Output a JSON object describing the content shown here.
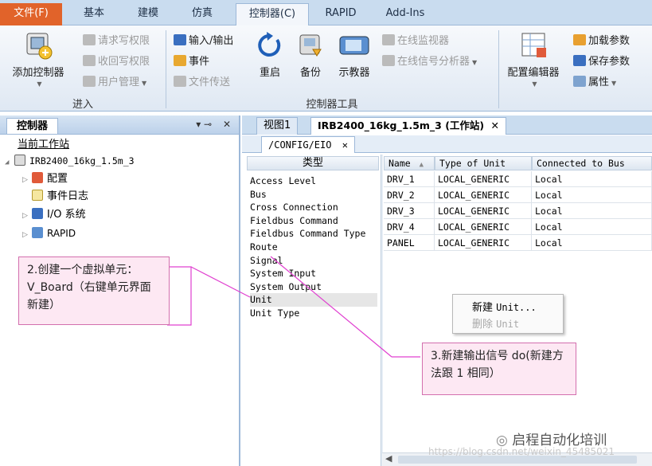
{
  "ribbon": {
    "tabs": [
      {
        "label": "文件(F)"
      },
      {
        "label": "基本"
      },
      {
        "label": "建模"
      },
      {
        "label": "仿真"
      },
      {
        "label": "控制器(C)"
      },
      {
        "label": "RAPID"
      },
      {
        "label": "Add-Ins"
      }
    ],
    "groups": {
      "input": {
        "label": "进入",
        "add_controller": "添加控制器",
        "request_write": "请求写权限",
        "recall_write": "收回写权限",
        "user_mgmt": "用户管理"
      },
      "tools": {
        "label": "控制器工具",
        "io": "输入/输出",
        "events": "事件",
        "file_transfer": "文件传送",
        "restart": "重启",
        "backup": "备份",
        "teach_pendant": "示教器",
        "online_monitor": "在线监视器",
        "online_signal": "在线信号分析器"
      },
      "config": {
        "config_editor": "配置编辑器",
        "load_params": "加载参数",
        "save_params": "保存参数",
        "properties": "属性"
      }
    }
  },
  "left_panel": {
    "title": "控制器",
    "current_station": "当前工作站",
    "station": "IRB2400_16kg_1.5m_3",
    "items": [
      {
        "label": "配置"
      },
      {
        "label": "事件日志"
      },
      {
        "label": "I/O 系统"
      },
      {
        "label": "RAPID"
      }
    ]
  },
  "doc_tabs": {
    "view1": "视图1",
    "station_tab": "IRB2400_16kg_1.5m_3 (工作站)",
    "config_tab": "/CONFIG/EIO"
  },
  "type_list": {
    "header": "类型",
    "items": [
      "Access Level",
      "Bus",
      "Cross Connection",
      "Fieldbus Command",
      "Fieldbus Command Type",
      "Route",
      "Signal",
      "System Input",
      "System Output",
      "Unit",
      "Unit Type"
    ],
    "selected": "Unit"
  },
  "grid": {
    "columns": [
      "Name",
      "Type of Unit",
      "Connected to Bus"
    ],
    "rows": [
      [
        "DRV_1",
        "LOCAL_GENERIC",
        "Local"
      ],
      [
        "DRV_2",
        "LOCAL_GENERIC",
        "Local"
      ],
      [
        "DRV_3",
        "LOCAL_GENERIC",
        "Local"
      ],
      [
        "DRV_4",
        "LOCAL_GENERIC",
        "Local"
      ],
      [
        "PANEL",
        "LOCAL_GENERIC",
        "Local"
      ]
    ]
  },
  "context_menu": {
    "new_cn": "新建",
    "new_en": "Unit...",
    "delete_cn": "删除",
    "delete_en": "Unit"
  },
  "annotations": {
    "note1": "2.创建一个虚拟单元：V_Board（右键单元界面新建）",
    "note2": "3.新建输出信号 do(新建方法跟 1 相同）"
  },
  "watermark": {
    "brand": "启程自动化培训",
    "url": "https://blog.csdn.net/weixin_45485021"
  },
  "colors": {
    "file_tab": "#e1632a",
    "annotation_border": "#d36fae",
    "annotation_fill": "#fde8f3",
    "arrow": "#e040d0"
  }
}
